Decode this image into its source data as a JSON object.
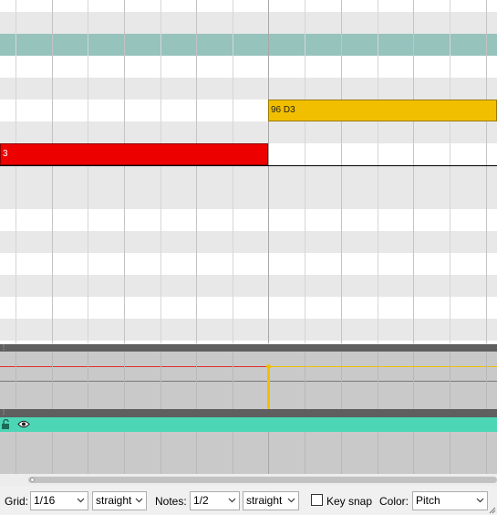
{
  "notes": [
    {
      "label": "96 D3",
      "color": "#f2bf00"
    },
    {
      "label": "3",
      "color": "#ec0000"
    }
  ],
  "toolbar": {
    "grid_label": "Grid:",
    "grid_value": "1/16",
    "grid_swing": "straight",
    "notes_label": "Notes:",
    "notes_value": "1/2",
    "notes_swing": "straight",
    "keysnap_label": "Key snap",
    "keysnap_checked": false,
    "color_label": "Color:",
    "color_value": "Pitch"
  },
  "icons": {
    "lock": "lock-icon",
    "eye": "eye-icon",
    "chevron": "chevron-down-icon"
  },
  "colors": {
    "row_highlight": "#96c3bc",
    "row_shade": "#e8e8e8",
    "cc_header": "#4dd6b6",
    "lane_bg": "#c9c9c9",
    "note_yellow": "#f2bf00",
    "note_red": "#ec0000"
  }
}
